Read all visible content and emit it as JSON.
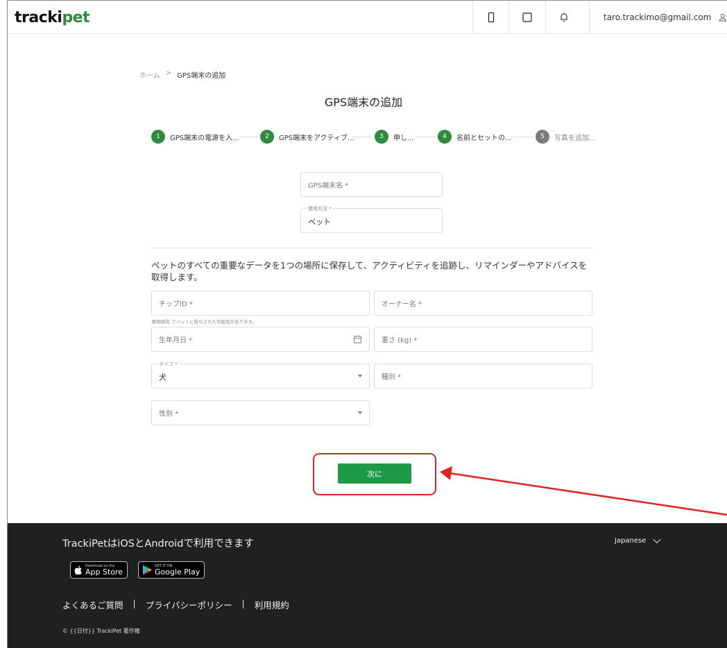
{
  "header": {
    "logo_part1": "tracki",
    "logo_part2": "pet",
    "account_email": "taro.trackimo@gmail.com",
    "icons": [
      "device-icon",
      "square-icon",
      "bell-icon",
      "user-icon"
    ]
  },
  "breadcrumb": {
    "home": "ホーム",
    "separator": ">",
    "current": "GPS端末の追加"
  },
  "page_title": "GPS端末の追加",
  "stepper": {
    "steps": [
      {
        "num": "1",
        "label": "GPS端末の電源を入...",
        "active": true
      },
      {
        "num": "2",
        "label": "GPS端末をアクティブ...",
        "active": true
      },
      {
        "num": "3",
        "label": "申し...",
        "active": true
      },
      {
        "num": "4",
        "label": "名前とセットの...",
        "active": true
      },
      {
        "num": "5",
        "label": "写真を追加...",
        "active": false
      }
    ]
  },
  "device_form": {
    "name_placeholder": "GPS端末名 *",
    "usage_label": "使用方法 *",
    "usage_value": "ペット"
  },
  "pet_form": {
    "description": "ペットのすべての重要なデータを1つの場所に保存して、アクティビティを追跡し、リマインダーやアドバイスを取得します。",
    "chip_placeholder": "チップID *",
    "chip_helper": "動物病院 でペットに投与された可能性があります。",
    "owner_placeholder": "オーナー名 *",
    "birthdate_placeholder": "生年月日 *",
    "weight_placeholder": "重さ (kg) *",
    "type_label": "タイプ *",
    "type_value": "犬",
    "breed_placeholder": "種別 *",
    "gender_placeholder": "性別 *"
  },
  "actions": {
    "next_label": "次に"
  },
  "colors": {
    "brand_green": "#1e9a46",
    "annotation_red": "#e0211d",
    "footer_bg": "#1f2022"
  },
  "footer": {
    "title": "TrackiPetはiOSとAndroidで利用できます",
    "language": "Japanese",
    "app_store_small": "Download on the",
    "app_store_big": "App Store",
    "google_play_small": "GET IT ON",
    "google_play_big": "Google Play",
    "links": [
      "よくあるご質問",
      "プライバシーポリシー",
      "利用規約"
    ],
    "link_separator": "|",
    "copyright": "© {{日付}} TrackiPet 著作権"
  }
}
